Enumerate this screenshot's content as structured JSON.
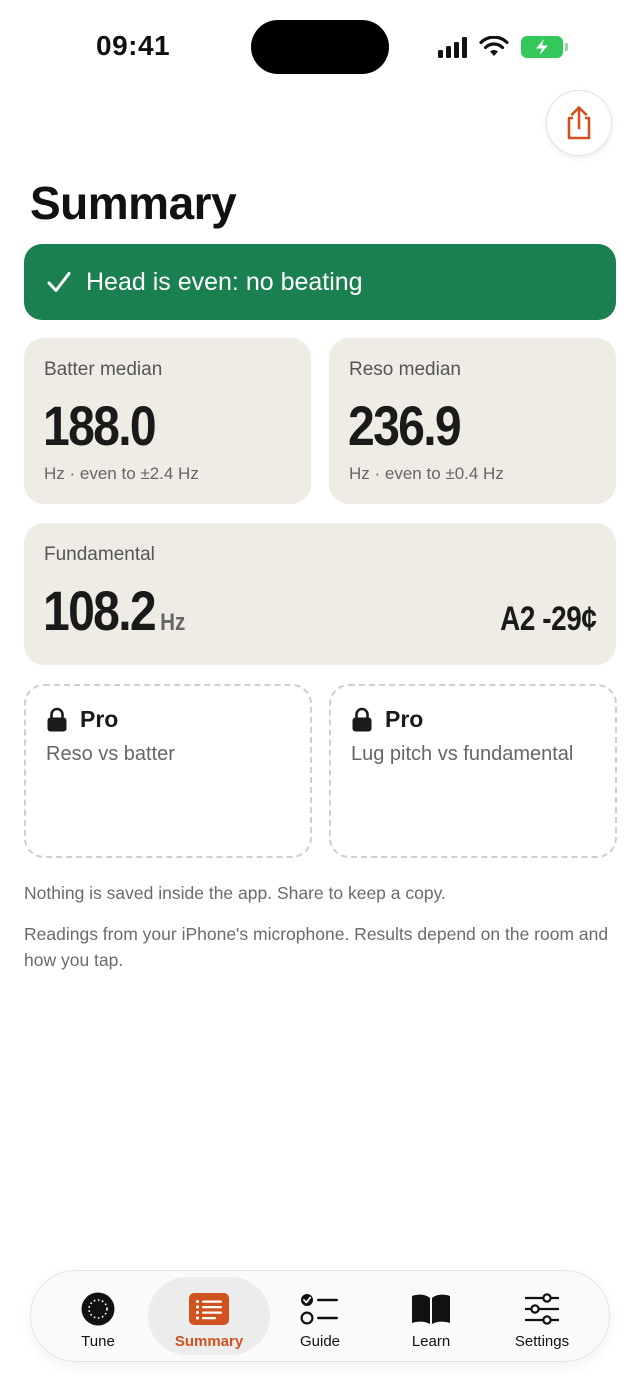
{
  "status_bar": {
    "time": "09:41",
    "accent_battery": "#34c759"
  },
  "header": {
    "title": "Summary",
    "share_icon": "share-icon"
  },
  "banner": {
    "icon": "checkmark-icon",
    "text": "Head is even: no beating",
    "color": "#1b8050"
  },
  "metrics": {
    "batter": {
      "label": "Batter median",
      "value": "188.0",
      "sub": "Hz · even to ±2.4 Hz"
    },
    "reso": {
      "label": "Reso median",
      "value": "236.9",
      "sub": "Hz · even to ±0.4 Hz"
    },
    "fundamental": {
      "label": "Fundamental",
      "value": "108.2",
      "unit": "Hz",
      "note": "A2 -29¢"
    }
  },
  "pro_cards": [
    {
      "badge": "Pro",
      "icon": "lock-icon",
      "description": "Reso vs batter"
    },
    {
      "badge": "Pro",
      "icon": "lock-icon",
      "description": "Lug pitch vs fundamental"
    }
  ],
  "footnotes": {
    "save_note": "Nothing is saved inside the app. Share to keep a copy.",
    "readings_note": "Readings from your iPhone's microphone. Results depend on the room and how you tap."
  },
  "tab_bar": {
    "active_color": "#d0531f",
    "tabs": [
      {
        "label": "Tune",
        "icon": "tune-icon"
      },
      {
        "label": "Summary",
        "icon": "summary-icon",
        "active": true
      },
      {
        "label": "Guide",
        "icon": "guide-icon"
      },
      {
        "label": "Learn",
        "icon": "book-icon"
      },
      {
        "label": "Settings",
        "icon": "sliders-icon"
      }
    ]
  }
}
